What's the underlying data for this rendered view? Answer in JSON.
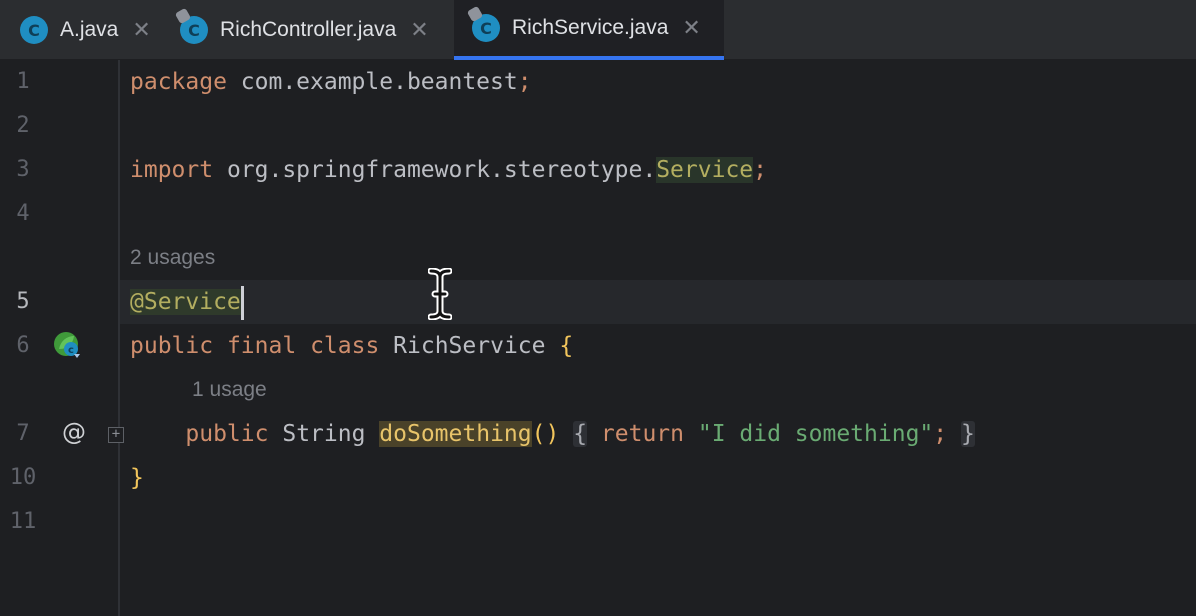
{
  "tabs": [
    {
      "label": "A.java",
      "icon": "java-class-icon",
      "close": "✕",
      "active": false
    },
    {
      "label": "RichController.java",
      "icon": "java-class-icon",
      "close": "✕",
      "active": false
    },
    {
      "label": "RichService.java",
      "icon": "java-class-icon",
      "close": "✕",
      "active": true
    }
  ],
  "class_icon_letter": "C",
  "gutter": {
    "line_numbers": [
      "1",
      "2",
      "3",
      "4",
      "5",
      "6",
      "7",
      "10",
      "11"
    ],
    "current_line": "5",
    "markers": {
      "bean": "spring-bean-icon",
      "at": "@",
      "fold": "+"
    }
  },
  "code": {
    "l1": {
      "kw": "package",
      "text": " com.example.beantest",
      "semi": ";"
    },
    "l3": {
      "kw": "import",
      "text": " org.springframework.stereotype.",
      "cls": "Service",
      "semi": ";"
    },
    "hint1": "2 usages",
    "l5": {
      "ann": "@Service"
    },
    "l6": {
      "kw1": "public",
      "kw2": "final",
      "kw3": "class",
      "name": "RichService",
      "brace": "{"
    },
    "hint2": "1 usage",
    "l7": {
      "kw": "public",
      "type": "String",
      "method": "doSomething",
      "parens": "()",
      "open": "{",
      "ret": "return",
      "str": "\"I did something\"",
      "semi": ";",
      "close": "}"
    },
    "l10": {
      "brace": "}"
    }
  },
  "colors": {
    "accent_tab_underline": "#3574f0",
    "keyword": "#cf8e6d",
    "annotation": "#b3ae60",
    "string": "#6aab73"
  }
}
